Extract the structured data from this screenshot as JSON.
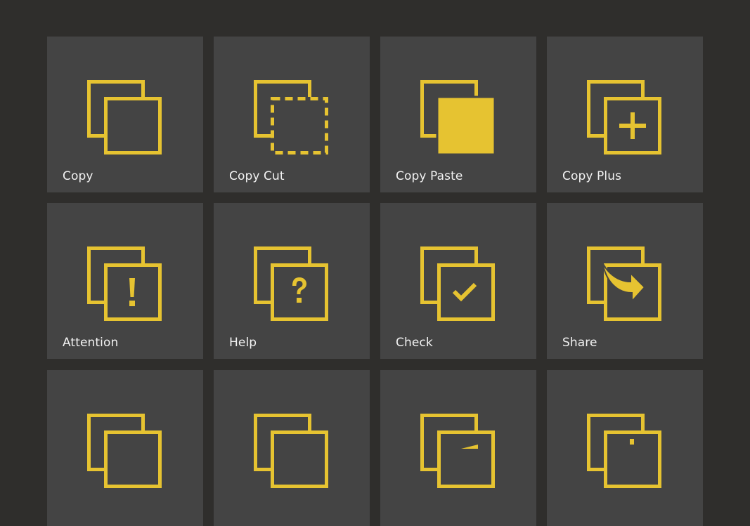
{
  "colors": {
    "background": "#2f2e2c",
    "tile": "#444444",
    "accent": "#e6c331",
    "label": "#f2f2f2"
  },
  "tiles": [
    {
      "label": "Copy",
      "icon": "copy-icon"
    },
    {
      "label": "Copy Cut",
      "icon": "copy-cut-icon"
    },
    {
      "label": "Copy Paste",
      "icon": "copy-paste-icon"
    },
    {
      "label": "Copy Plus",
      "icon": "copy-plus-icon"
    },
    {
      "label": "Attention",
      "icon": "copy-attention-icon"
    },
    {
      "label": "Help",
      "icon": "copy-help-icon"
    },
    {
      "label": "Check",
      "icon": "copy-check-icon"
    },
    {
      "label": "Share",
      "icon": "copy-share-icon"
    },
    {
      "label": "",
      "icon": "copy-icon-partial-1"
    },
    {
      "label": "",
      "icon": "copy-icon-partial-2"
    },
    {
      "label": "",
      "icon": "copy-icon-partial-3"
    },
    {
      "label": "",
      "icon": "copy-icon-partial-4"
    }
  ]
}
